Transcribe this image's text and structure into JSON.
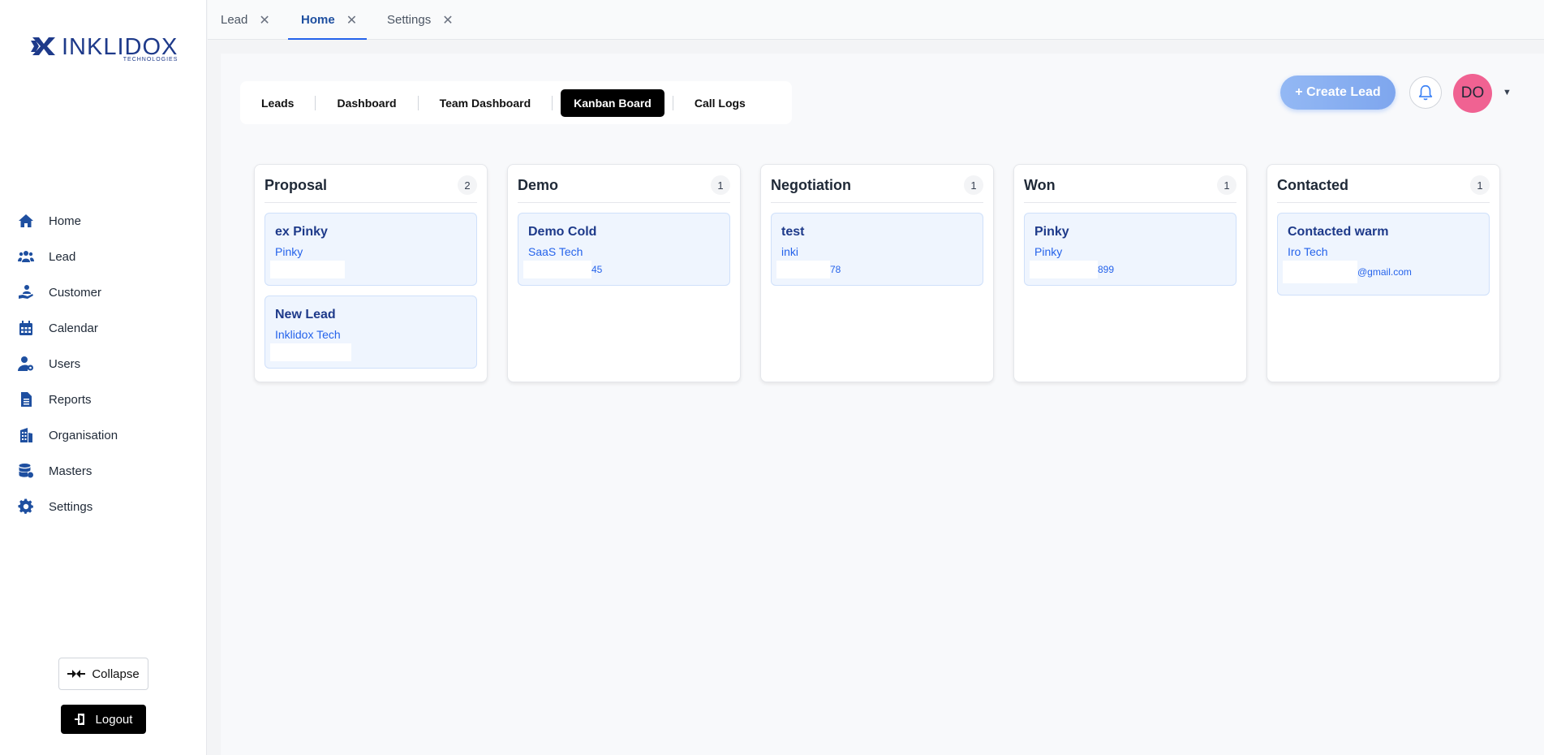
{
  "brand": {
    "name": "INKLIDOX",
    "subtitle": "TECHNOLOGIES"
  },
  "sidebar": {
    "items": [
      {
        "label": "Home",
        "icon": "home-icon"
      },
      {
        "label": "Lead",
        "icon": "users-group-icon"
      },
      {
        "label": "Customer",
        "icon": "customer-icon"
      },
      {
        "label": "Calendar",
        "icon": "calendar-icon"
      },
      {
        "label": "Users",
        "icon": "user-gear-icon"
      },
      {
        "label": "Reports",
        "icon": "file-icon"
      },
      {
        "label": "Organisation",
        "icon": "building-icon"
      },
      {
        "label": "Masters",
        "icon": "database-icon"
      },
      {
        "label": "Settings",
        "icon": "gear-icon"
      }
    ],
    "collapse_label": "Collapse",
    "logout_label": "Logout"
  },
  "tabs": [
    {
      "label": "Lead",
      "active": false
    },
    {
      "label": "Home",
      "active": true
    },
    {
      "label": "Settings",
      "active": false
    }
  ],
  "subnav": [
    "Leads",
    "Dashboard",
    "Team Dashboard",
    "Kanban Board",
    "Call Logs"
  ],
  "subnav_active": "Kanban Board",
  "header": {
    "create_label": "+ Create Lead",
    "avatar_initials": "DO"
  },
  "columns": [
    {
      "title": "Proposal",
      "count": "2",
      "cards": [
        {
          "title": "ex Pinky",
          "company": "Pinky",
          "contact": ""
        },
        {
          "title": "New Lead",
          "company": "Inklidox Tech",
          "contact": ""
        }
      ]
    },
    {
      "title": "Demo",
      "count": "1",
      "cards": [
        {
          "title": "Demo Cold",
          "company": "SaaS Tech",
          "contact": "45"
        }
      ]
    },
    {
      "title": "Negotiation",
      "count": "1",
      "cards": [
        {
          "title": "test",
          "company": "inki",
          "contact": "78"
        }
      ]
    },
    {
      "title": "Won",
      "count": "1",
      "cards": [
        {
          "title": "Pinky",
          "company": "Pinky",
          "contact": "899"
        }
      ]
    },
    {
      "title": "Contacted",
      "count": "1",
      "cards": [
        {
          "title": "Contacted warm",
          "company": "Iro Tech",
          "contact": "@gmail.com"
        }
      ]
    }
  ],
  "colors": {
    "primary": "#1e4fa0",
    "accent": "#2563eb",
    "avatar": "#f06292",
    "active_subnav": "#000000"
  }
}
